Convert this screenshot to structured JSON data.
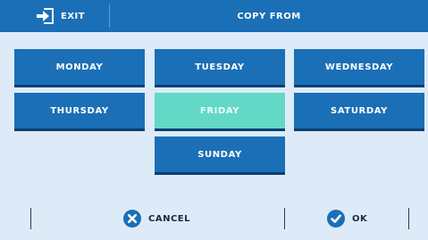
{
  "header": {
    "exit_label": "EXIT",
    "title": "COPY FROM"
  },
  "days": [
    {
      "label": "MONDAY",
      "selected": false
    },
    {
      "label": "TUESDAY",
      "selected": false
    },
    {
      "label": "WEDNESDAY",
      "selected": false
    },
    {
      "label": "THURSDAY",
      "selected": false
    },
    {
      "label": "FRIDAY",
      "selected": true
    },
    {
      "label": "SATURDAY",
      "selected": false
    },
    {
      "label": "SUNDAY",
      "selected": false
    }
  ],
  "footer": {
    "cancel_label": "CANCEL",
    "ok_label": "OK"
  },
  "icons": {
    "exit": "exit-door-icon",
    "cancel": "x-circle-icon",
    "ok": "check-circle-icon"
  },
  "colors": {
    "header_bg": "#1b6fb6",
    "button_bg": "#1b6fb6",
    "selected_bg": "#63d8c6",
    "page_bg": "#dcebf7"
  }
}
